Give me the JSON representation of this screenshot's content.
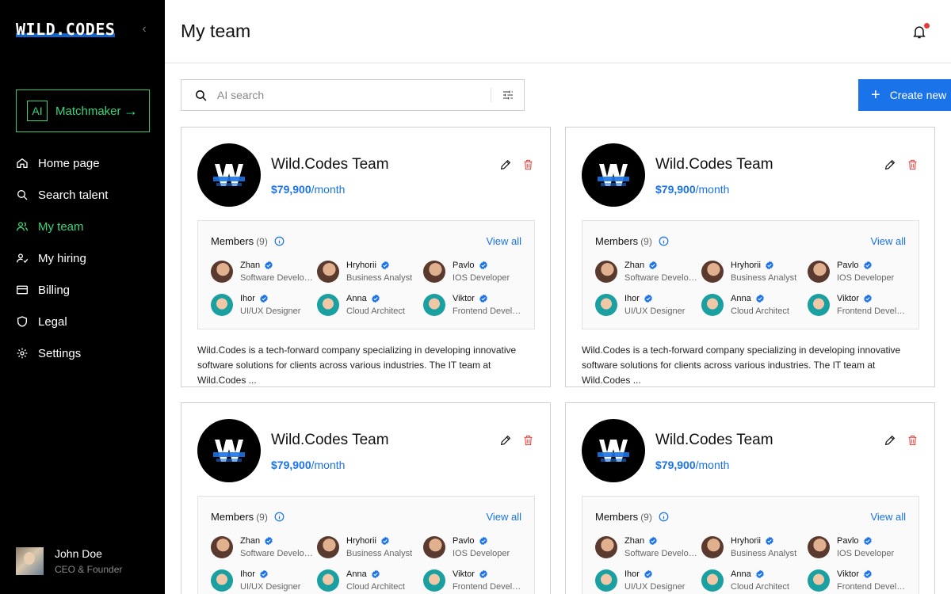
{
  "sidebar": {
    "logo": "WILD.CODES",
    "collapse_icon": "chevron-left-icon",
    "matchmaker": {
      "badge": "AI",
      "label": "Matchmaker",
      "arrow": "→"
    },
    "nav": [
      {
        "label": "Home page",
        "icon": "home-icon"
      },
      {
        "label": "Search talent",
        "icon": "search-icon"
      },
      {
        "label": "My team",
        "icon": "users-icon",
        "active": true
      },
      {
        "label": "My hiring",
        "icon": "user-check-icon"
      },
      {
        "label": "Billing",
        "icon": "card-icon"
      },
      {
        "label": "Legal",
        "icon": "shield-icon"
      },
      {
        "label": "Settings",
        "icon": "gear-icon"
      }
    ],
    "user": {
      "name": "John Doe",
      "role": "CEO & Founder"
    }
  },
  "header": {
    "title": "My team",
    "bell_icon": "bell-icon"
  },
  "toolbar": {
    "search_placeholder": "AI search",
    "create_label": "Create new"
  },
  "colors": {
    "accent": "#1a73e8",
    "active": "#37d77a",
    "danger": "#e53935",
    "sidebar_bg": "#000000"
  },
  "cards": [
    {
      "title": "Wild.Codes Team",
      "price": "$79,900",
      "price_unit": "/month",
      "members_label": "Members",
      "members_count": "(9)",
      "view_all": "View all",
      "members": [
        {
          "name": "Zhan",
          "role": "Software Developer"
        },
        {
          "name": "Hryhorii",
          "role": "Business Analyst"
        },
        {
          "name": "Pavlo",
          "role": "IOS Developer"
        },
        {
          "name": "Ihor",
          "role": "UI/UX Designer"
        },
        {
          "name": "Anna",
          "role": "Cloud Architect"
        },
        {
          "name": "Viktor",
          "role": "Frontend Developer"
        }
      ],
      "description": "Wild.Codes is a tech-forward company specializing in developing innovative software solutions for clients across various industries. The IT team at Wild.Codes ..."
    },
    {
      "title": "Wild.Codes Team",
      "price": "$79,900",
      "price_unit": "/month",
      "members_label": "Members",
      "members_count": "(9)",
      "view_all": "View all",
      "members": [
        {
          "name": "Zhan",
          "role": "Software Developer"
        },
        {
          "name": "Hryhorii",
          "role": "Business Analyst"
        },
        {
          "name": "Pavlo",
          "role": "IOS Developer"
        },
        {
          "name": "Ihor",
          "role": "UI/UX Designer"
        },
        {
          "name": "Anna",
          "role": "Cloud Architect"
        },
        {
          "name": "Viktor",
          "role": "Frontend Developer"
        }
      ],
      "description": "Wild.Codes is a tech-forward company specializing in developing innovative software solutions for clients across various industries. The IT team at Wild.Codes ..."
    },
    {
      "title": "Wild.Codes Team",
      "price": "$79,900",
      "price_unit": "/month",
      "members_label": "Members",
      "members_count": "(9)",
      "view_all": "View all",
      "members": [
        {
          "name": "Zhan",
          "role": "Software Developer"
        },
        {
          "name": "Hryhorii",
          "role": "Business Analyst"
        },
        {
          "name": "Pavlo",
          "role": "IOS Developer"
        },
        {
          "name": "Ihor",
          "role": "UI/UX Designer"
        },
        {
          "name": "Anna",
          "role": "Cloud Architect"
        },
        {
          "name": "Viktor",
          "role": "Frontend Developer"
        }
      ],
      "description": ""
    },
    {
      "title": "Wild.Codes Team",
      "price": "$79,900",
      "price_unit": "/month",
      "members_label": "Members",
      "members_count": "(9)",
      "view_all": "View all",
      "members": [
        {
          "name": "Zhan",
          "role": "Software Developer"
        },
        {
          "name": "Hryhorii",
          "role": "Business Analyst"
        },
        {
          "name": "Pavlo",
          "role": "IOS Developer"
        },
        {
          "name": "Ihor",
          "role": "UI/UX Designer"
        },
        {
          "name": "Anna",
          "role": "Cloud Architect"
        },
        {
          "name": "Viktor",
          "role": "Frontend Developer"
        }
      ],
      "description": ""
    }
  ]
}
